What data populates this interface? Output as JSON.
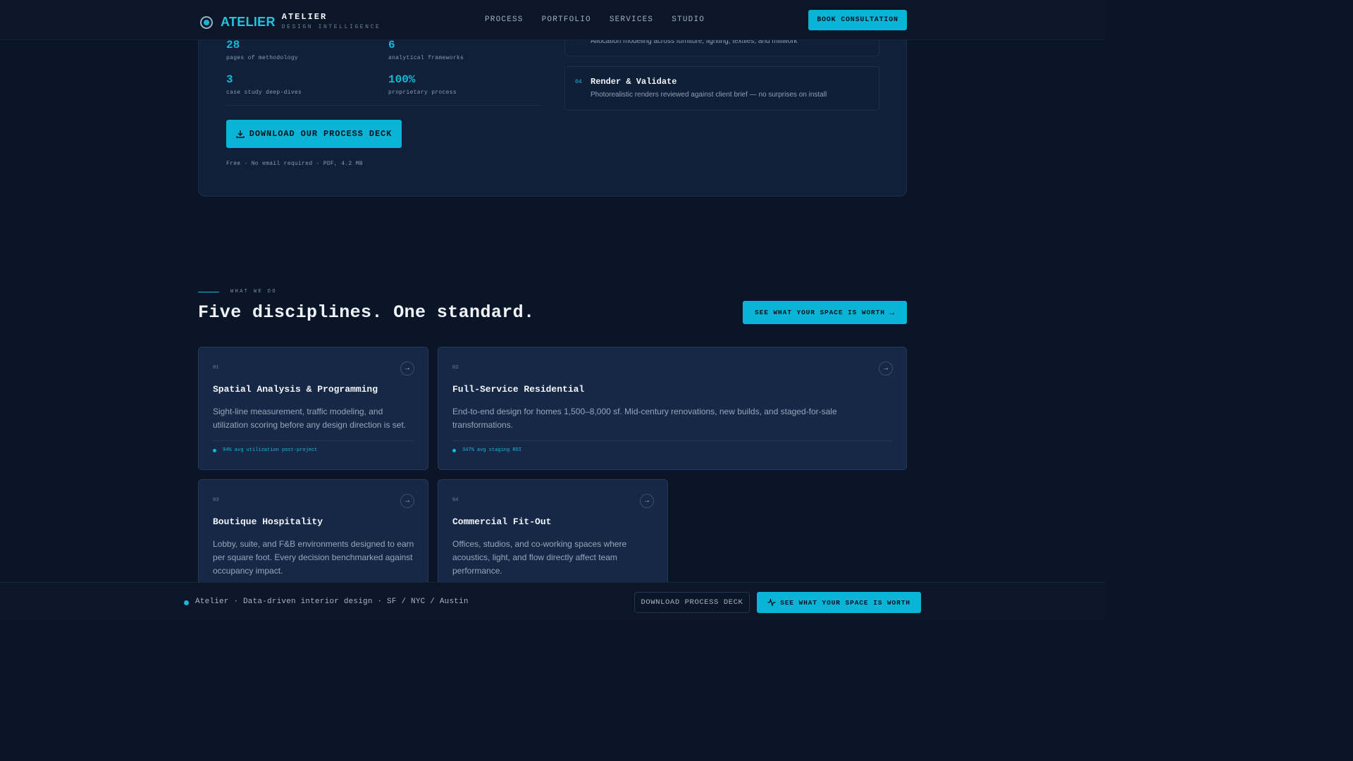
{
  "header": {
    "brand_word": "ATELIER",
    "brand_title": "ATELIER",
    "brand_subtitle": "DESIGN INTELLIGENCE",
    "nav": [
      "PROCESS",
      "PORTFOLIO",
      "SERVICES",
      "STUDIO"
    ],
    "cta": "BOOK CONSULTATION"
  },
  "deck": {
    "stats": [
      {
        "value": "28",
        "label": "pages of methodology"
      },
      {
        "value": "6",
        "label": "analytical frameworks"
      },
      {
        "value": "3",
        "label": "case study deep-dives"
      },
      {
        "value": "100%",
        "label": "proprietary process"
      }
    ],
    "download_label": "DOWNLOAD OUR PROCESS DECK",
    "note": "Free · No email required · PDF, 4.2 MB",
    "steps": [
      {
        "number": "",
        "title": "",
        "description": "Allocation modeling across furniture, lighting, textiles, and millwork"
      },
      {
        "number": "04",
        "title": "Render & Validate",
        "description": "Photorealistic renders reviewed against client brief — no surprises on install"
      }
    ]
  },
  "disciplines": {
    "eyebrow": "WHAT WE DO",
    "title": "Five disciplines. One standard.",
    "cta": "SEE WHAT YOUR SPACE IS WORTH",
    "cards": [
      {
        "number": "01",
        "title": "Spatial Analysis & Programming",
        "description": "Sight-line measurement, traffic modeling, and utilization scoring before any design direction is set.",
        "metric": "94% avg utilization post-project"
      },
      {
        "number": "02",
        "title": "Full-Service Residential",
        "description": "End-to-end design for homes 1,500–8,000 sf. Mid-century renovations, new builds, and staged-for-sale transformations.",
        "metric": "347% avg staging ROI"
      },
      {
        "number": "03",
        "title": "Boutique Hospitality",
        "description": "Lobby, suite, and F&B environments designed to earn per square foot. Every decision benchmarked against occupancy impact.",
        "metric": ""
      },
      {
        "number": "04",
        "title": "Commercial Fit-Out",
        "description": "Offices, studios, and co-working spaces where acoustics, light, and flow directly affect team performance.",
        "metric": ""
      }
    ]
  },
  "footer_bar": {
    "text": "Atelier · Data-driven interior design · SF / NYC / Austin",
    "secondary": "DOWNLOAD PROCESS DECK",
    "primary": "SEE WHAT YOUR SPACE IS WORTH"
  },
  "colors": {
    "accent": "#0ab4d6",
    "background": "#0a1628",
    "card": "#172847"
  }
}
